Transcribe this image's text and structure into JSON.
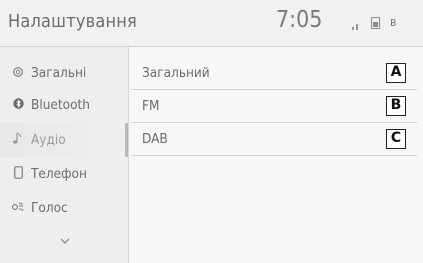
{
  "header": {
    "title": "Налаштування",
    "time": "7:05",
    "status_icons": [
      "signal-icon",
      "battery-icon",
      "bluetooth-icon"
    ]
  },
  "sidebar": {
    "items": [
      {
        "label": "Загальні",
        "icon": "gear-icon"
      },
      {
        "label": "Bluetooth",
        "icon": "bluetooth-icon"
      },
      {
        "label": "Аудіо",
        "icon": "music-note-icon",
        "active": true
      },
      {
        "label": "Телефон",
        "icon": "phone-icon"
      },
      {
        "label": "Голос",
        "icon": "voice-icon"
      }
    ],
    "more_icon": "chevron-down-icon"
  },
  "main": {
    "rows": [
      {
        "label": "Загальний",
        "marker": "A"
      },
      {
        "label": "FM",
        "marker": "B"
      },
      {
        "label": "DAB",
        "marker": "C"
      }
    ]
  },
  "colors": {
    "background": "#f7f7f7",
    "sidebar": "#eeeeee",
    "text": "#6b6b6b",
    "marker_border": "#222222"
  }
}
